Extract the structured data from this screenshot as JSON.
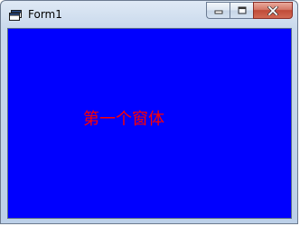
{
  "window": {
    "title": "Form1",
    "client_background": "#0000ff"
  },
  "caption_buttons": {
    "minimize_icon": "minimize-icon",
    "maximize_icon": "maximize-icon",
    "close_icon": "close-icon"
  },
  "form": {
    "label_text": "第一个窗体",
    "label_color": "#ff0000"
  }
}
